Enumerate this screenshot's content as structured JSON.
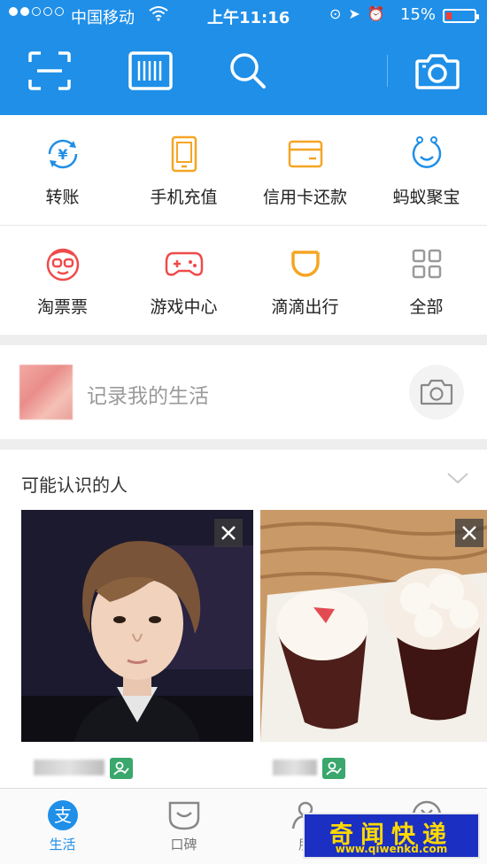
{
  "status_bar": {
    "carrier": "中国移动",
    "time": "上午11:16",
    "battery_percent": "15%",
    "battery_level": 0.15,
    "signal_bars_filled": 2,
    "signal_bars_total": 5,
    "icons": [
      "wifi-icon",
      "rotation-lock-icon",
      "location-icon",
      "alarm-icon"
    ]
  },
  "header": {
    "buttons": [
      {
        "name": "scan-icon"
      },
      {
        "name": "barcode-pay-icon"
      },
      {
        "name": "search-icon"
      },
      {
        "name": "camera-icon"
      }
    ],
    "accent": "#1f8fe8"
  },
  "quick_grid": [
    {
      "label": "转账",
      "icon": "transfer-icon",
      "color": "#1f8fe8"
    },
    {
      "label": "手机充值",
      "icon": "phone-recharge-icon",
      "color": "#f5a524"
    },
    {
      "label": "信用卡还款",
      "icon": "credit-card-icon",
      "color": "#f5a524"
    },
    {
      "label": "蚂蚁聚宝",
      "icon": "ant-fortune-icon",
      "color": "#1f8fe8"
    },
    {
      "label": "淘票票",
      "icon": "taopiaopiao-icon",
      "color": "#ef4b4b"
    },
    {
      "label": "游戏中心",
      "icon": "game-controller-icon",
      "color": "#ef4b4b"
    },
    {
      "label": "滴滴出行",
      "icon": "didi-icon",
      "color": "#f5a524"
    },
    {
      "label": "全部",
      "icon": "all-grid-icon",
      "color": "#999999"
    }
  ],
  "record": {
    "placeholder": "记录我的生活"
  },
  "people": {
    "title": "可能认识的人"
  },
  "tabbar": [
    {
      "label": "生活",
      "icon": "alipay-icon",
      "active": true
    },
    {
      "label": "口碑",
      "icon": "koubei-icon",
      "active": false
    },
    {
      "label": "朋",
      "icon": "friends-icon",
      "active": false
    },
    {
      "label": "",
      "icon": "close-circle-icon",
      "active": false
    }
  ],
  "watermark": {
    "main": "奇闻快递",
    "url": "www.qiwenkd.com"
  }
}
